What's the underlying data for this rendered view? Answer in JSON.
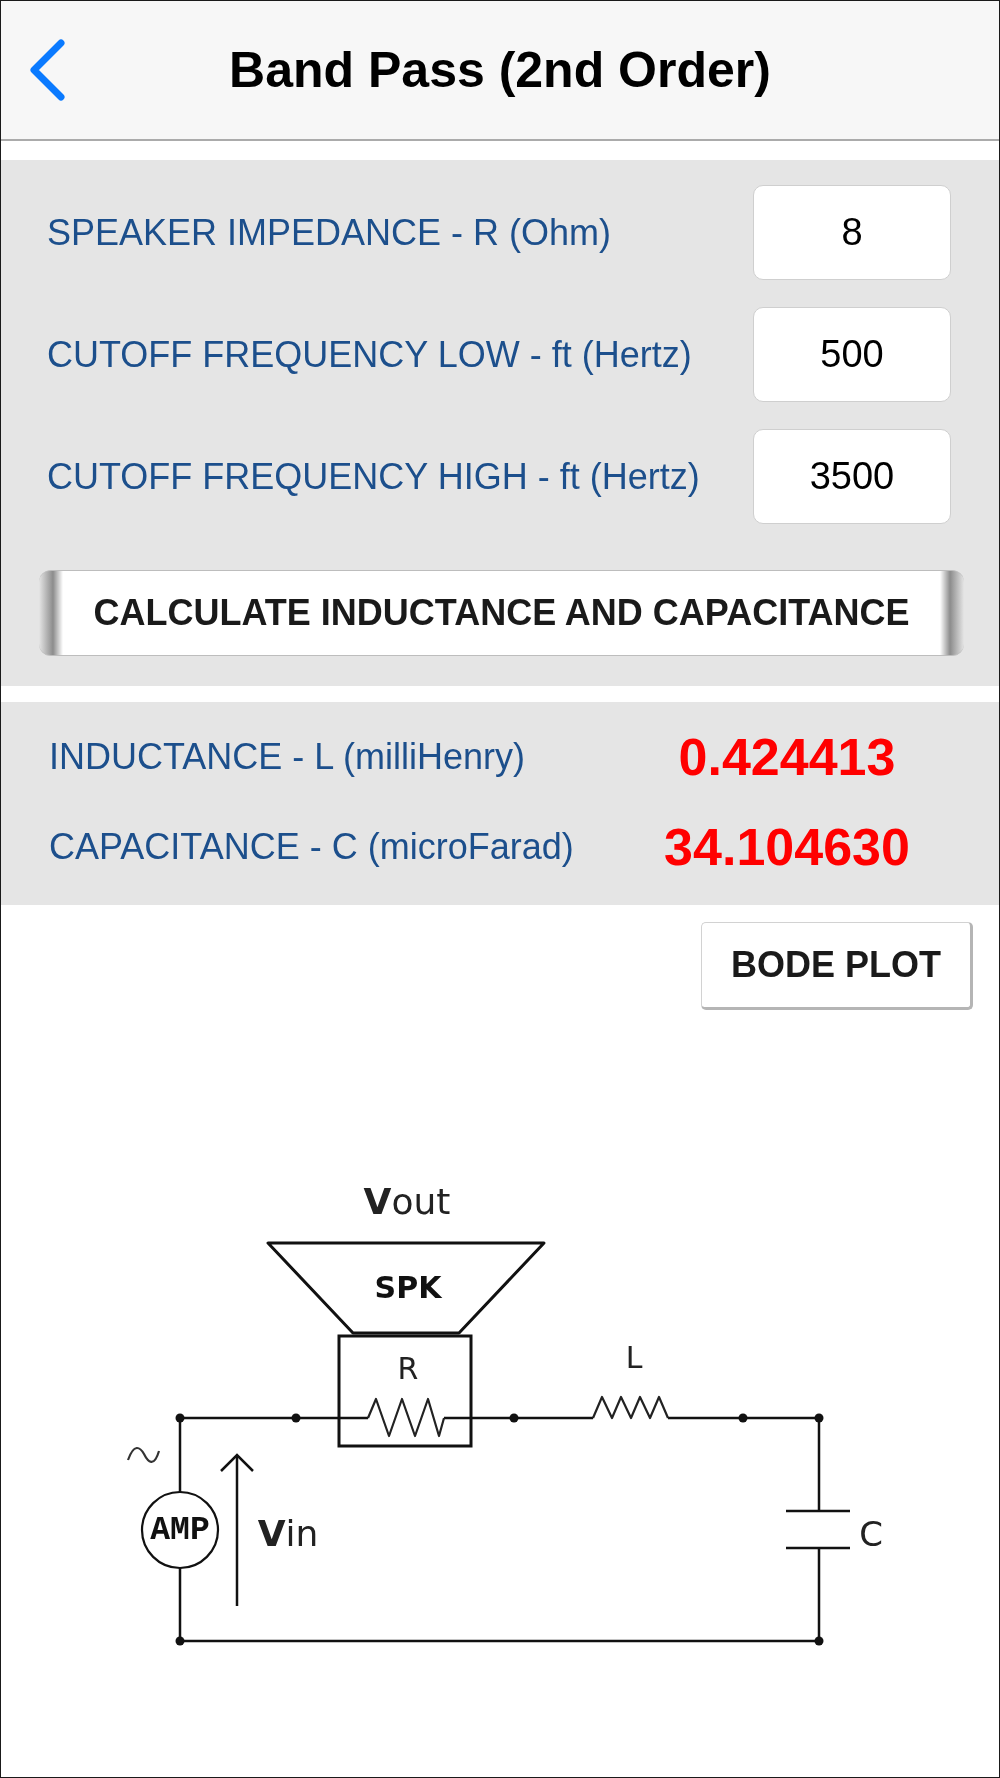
{
  "nav_bar": {
    "title": "Band Pass (2nd Order)"
  },
  "inputs": [
    {
      "label": "SPEAKER IMPEDANCE - R (Ohm)",
      "value": "8"
    },
    {
      "label": "CUTOFF FREQUENCY LOW - ft (Hertz)",
      "value": "500"
    },
    {
      "label": "CUTOFF FREQUENCY HIGH - ft (Hertz)",
      "value": "3500"
    }
  ],
  "calculate_button": {
    "label": "CALCULATE INDUCTANCE AND CAPACITANCE"
  },
  "results": [
    {
      "label": "INDUCTANCE - L (milliHenry)",
      "value": "0.424413"
    },
    {
      "label": "CAPACITANCE - C (microFarad)",
      "value": "34.104630"
    }
  ],
  "bode_plot_button": {
    "label": "BODE PLOT"
  },
  "circuit": {
    "output_label": "**V**out",
    "speaker_label": "SPK",
    "resistor_label": "R",
    "inductor_label": "L",
    "source_label": "AMP",
    "input_label": "**V**in",
    "capacitor_label": "C"
  }
}
